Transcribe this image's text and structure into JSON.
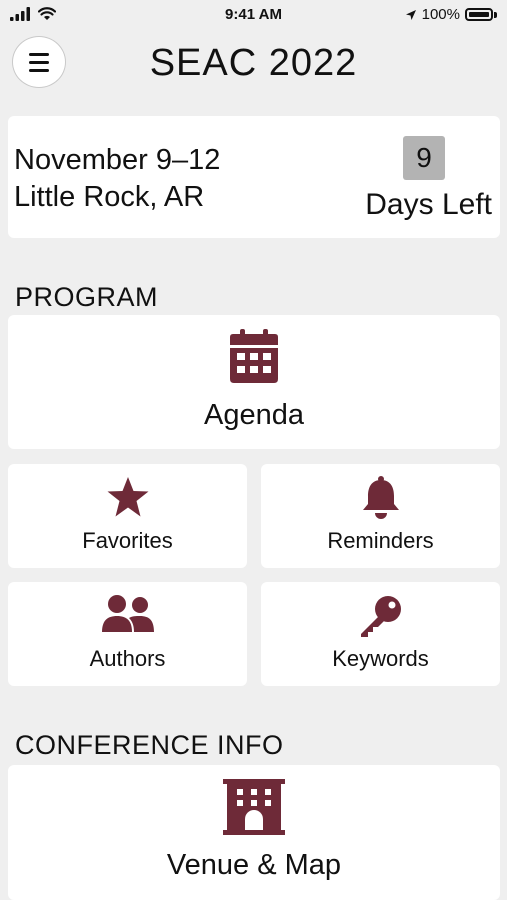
{
  "status_bar": {
    "time": "9:41 AM",
    "battery": "100%",
    "icons": [
      "signal-icon",
      "wifi-icon",
      "location-arrow-icon",
      "battery-icon"
    ]
  },
  "header": {
    "title": "SEAC 2022",
    "menu_icon": "hamburger-menu-icon"
  },
  "event": {
    "dates": "November 9–12",
    "location": "Little Rock, AR",
    "days_left_count": "9",
    "days_left_label": "Days Left"
  },
  "program": {
    "heading": "PROGRAM",
    "items": [
      {
        "label": "Agenda",
        "icon": "calendar-icon"
      },
      {
        "label": "Favorites",
        "icon": "star-icon"
      },
      {
        "label": "Reminders",
        "icon": "bell-icon"
      },
      {
        "label": "Authors",
        "icon": "users-icon"
      },
      {
        "label": "Keywords",
        "icon": "key-icon"
      }
    ]
  },
  "conference_info": {
    "heading": "CONFERENCE INFO",
    "items": [
      {
        "label": "Venue & Map",
        "icon": "building-icon"
      }
    ]
  },
  "colors": {
    "accent": "#6e2a38",
    "background": "#efefef",
    "card": "#ffffff",
    "badge": "#b3b3b3"
  }
}
